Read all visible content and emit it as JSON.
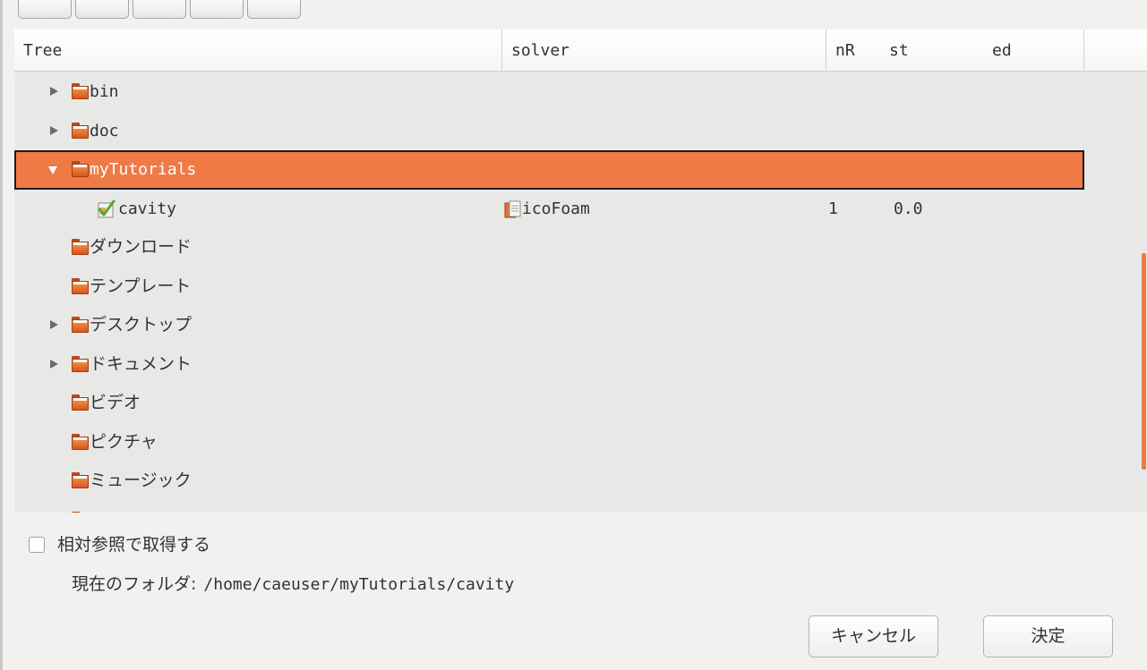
{
  "columns": {
    "tree": "Tree",
    "solver": "solver",
    "nR": "nR",
    "st": "st",
    "ed": "ed"
  },
  "rows": [
    {
      "label": "bin",
      "expander": "collapsed",
      "icon": "folder-icon"
    },
    {
      "label": "doc",
      "expander": "collapsed",
      "icon": "folder-icon"
    },
    {
      "label": "myTutorials",
      "expander": "expanded",
      "icon": "folder-icon",
      "selected": true
    },
    {
      "label": "cavity",
      "icon": "case-check-icon",
      "solver": "icoFoam",
      "nR": "1",
      "st": "0.0"
    },
    {
      "label": "ダウンロード",
      "icon": "folder-icon"
    },
    {
      "label": "テンプレート",
      "icon": "folder-icon"
    },
    {
      "label": "デスクトップ",
      "expander": "collapsed",
      "icon": "folder-icon"
    },
    {
      "label": "ドキュメント",
      "expander": "collapsed",
      "icon": "folder-icon"
    },
    {
      "label": "ビデオ",
      "icon": "folder-icon"
    },
    {
      "label": "ピクチャ",
      "icon": "folder-icon"
    },
    {
      "label": "ミュージック",
      "icon": "folder-icon"
    }
  ],
  "relative": {
    "label": "相対参照で取得する",
    "checked": false
  },
  "current_folder": {
    "label": "現在のフォルダ:",
    "path": "/home/caeuser/myTutorials/cavity"
  },
  "buttons": {
    "cancel": "キャンセル",
    "ok": "決定"
  },
  "colors": {
    "selection": "#ef7a45",
    "tree_bg": "#e8e8e7",
    "folder": "#e8672a"
  }
}
